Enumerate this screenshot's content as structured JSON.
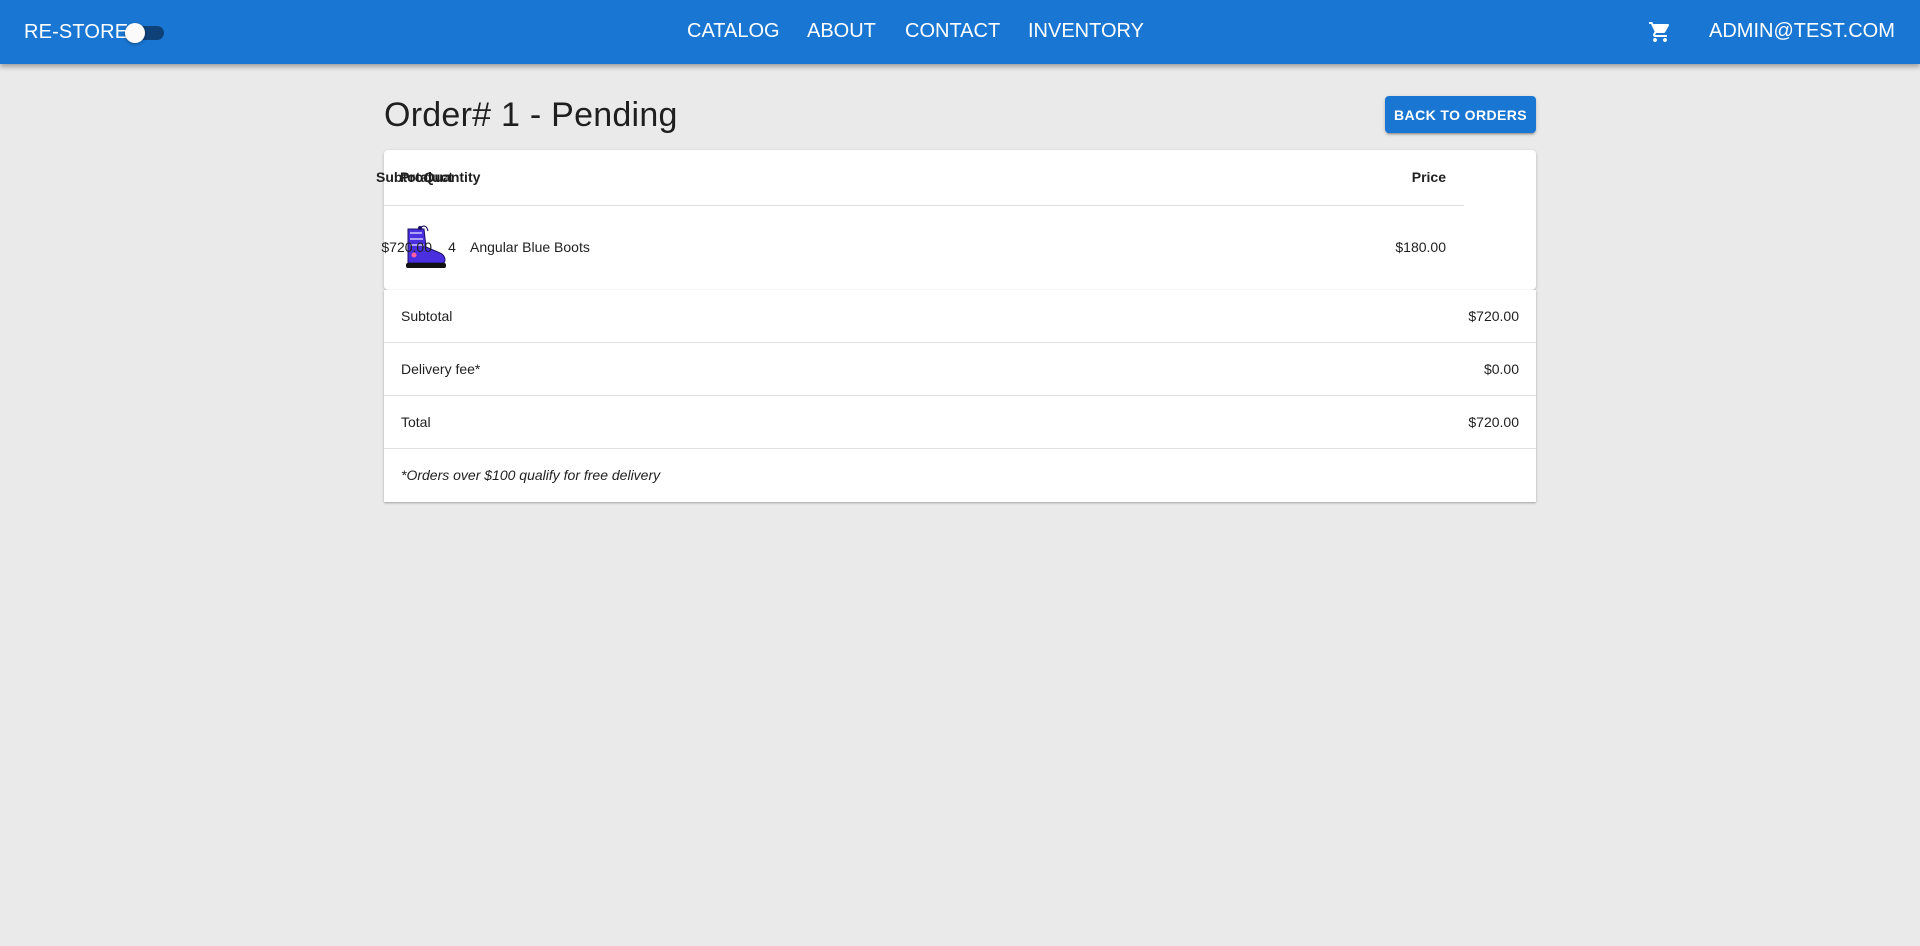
{
  "brand": {
    "name": "RE-STORE"
  },
  "theme_toggle": {
    "on": false
  },
  "nav": [
    {
      "label": "CATALOG"
    },
    {
      "label": "ABOUT"
    },
    {
      "label": "CONTACT"
    },
    {
      "label": "INVENTORY"
    }
  ],
  "user": {
    "email": "ADMIN@TEST.COM"
  },
  "colors": {
    "appbar": "#1976d2",
    "background": "#eaeaea",
    "boot": "#4a2fe0"
  },
  "icons": {
    "cart": "shopping-cart-icon",
    "product": "blue-boot-image"
  },
  "page": {
    "title": "Order# 1 - Pending",
    "back_label": "Back to orders"
  },
  "table": {
    "columns": {
      "product": "Product",
      "price": "Price",
      "quantity": "Quantity",
      "subtotal": "Subtotal"
    },
    "rows": [
      {
        "name": "Angular Blue Boots",
        "price": "$180.00",
        "quantity": "4",
        "subtotal": "$720.00"
      }
    ]
  },
  "summary": {
    "subtotal_label": "Subtotal",
    "subtotal_value": "$720.00",
    "delivery_label": "Delivery fee*",
    "delivery_value": "$0.00",
    "total_label": "Total",
    "total_value": "$720.00",
    "note": "*Orders over $100 qualify for free delivery"
  }
}
